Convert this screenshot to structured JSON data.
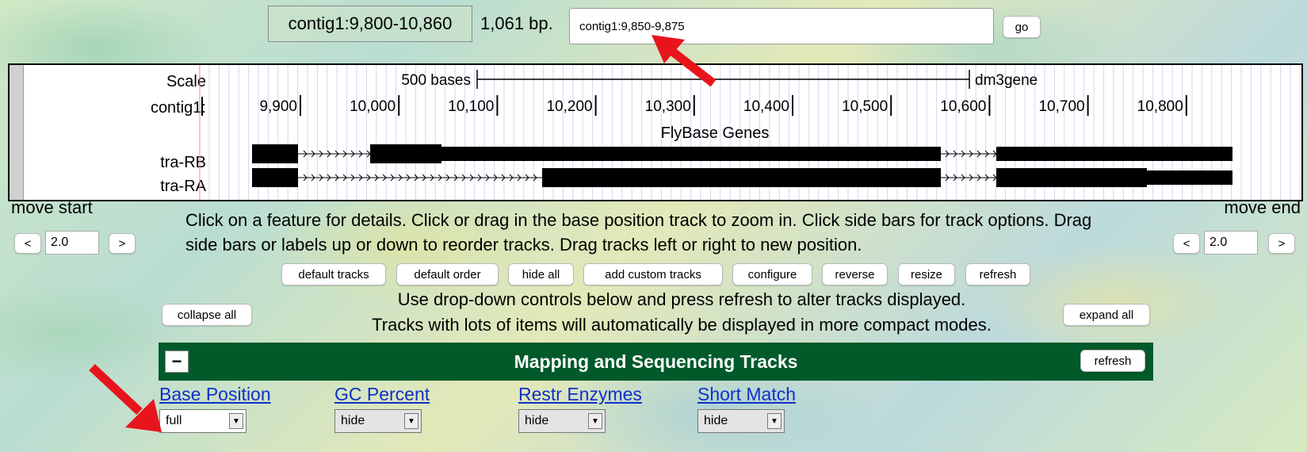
{
  "position": {
    "range": "contig1:9,800-10,860",
    "size": "1,061 bp.",
    "input_value": "contig1:9,850-9,875",
    "go_label": "go"
  },
  "tracks_image": {
    "scale_label": "Scale",
    "scale_bar_text": "500 bases",
    "assembly": "dm3gene",
    "chrom_label": "contig1:",
    "ticks": [
      "9,900",
      "10,000",
      "10,100",
      "10,200",
      "10,300",
      "10,400",
      "10,500",
      "10,600",
      "10,700",
      "10,800"
    ],
    "gene_track_title": "FlyBase Genes",
    "genes": [
      {
        "name": "tra-RB"
      },
      {
        "name": "tra-RA"
      }
    ]
  },
  "navigation": {
    "move_start_label": "move start",
    "move_end_label": "move end",
    "left_btn": "<",
    "right_btn": ">",
    "move_start_value": "2.0",
    "move_end_value": "2.0"
  },
  "help_text": "Click on a feature for details. Click or drag in the base position track to zoom in. Click side bars for track options. Drag side bars or labels up or down to reorder tracks. Drag tracks left or right to new position.",
  "buttons": {
    "default_tracks": "default tracks",
    "default_order": "default order",
    "hide_all": "hide all",
    "add_custom_tracks": "add custom tracks",
    "configure": "configure",
    "reverse": "reverse",
    "resize": "resize",
    "refresh": "refresh",
    "collapse_all": "collapse all",
    "expand_all": "expand all"
  },
  "controls_text": {
    "line1": "Use drop-down controls below and press refresh to alter tracks displayed.",
    "line2": "Tracks with lots of items will automatically be displayed in more compact modes."
  },
  "track_group": {
    "title": "Mapping and Sequencing Tracks",
    "collapse_symbol": "−",
    "refresh_label": "refresh",
    "color": "#005a2a",
    "tracks": [
      {
        "name": "Base Position",
        "mode": "full"
      },
      {
        "name": "GC Percent",
        "mode": "hide"
      },
      {
        "name": "Restr Enzymes",
        "mode": "hide"
      },
      {
        "name": "Short Match",
        "mode": "hide"
      }
    ]
  },
  "accent_colors": {
    "annotation_arrow": "#e8141c",
    "link": "#1030c8"
  }
}
